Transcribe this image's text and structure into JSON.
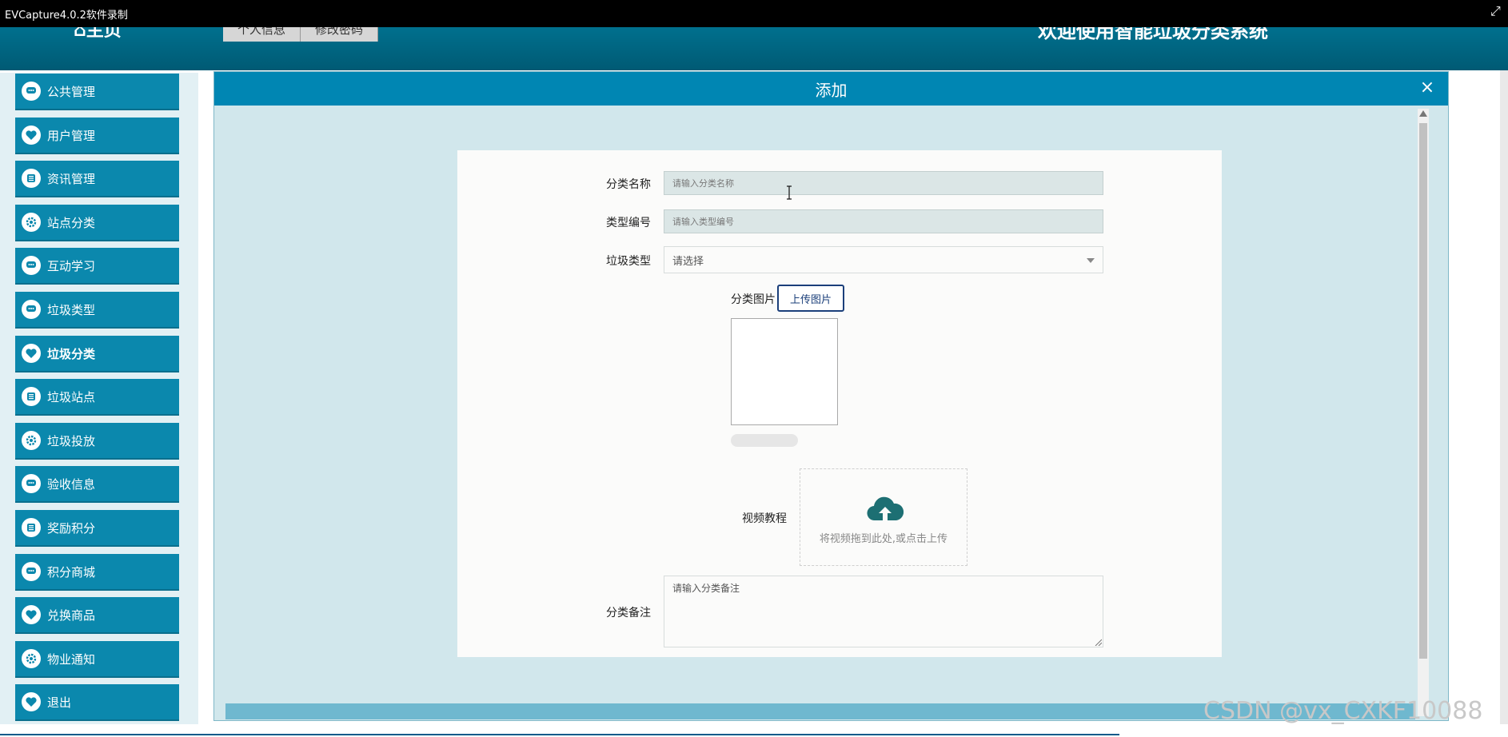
{
  "capture": {
    "title": "EVCapture4.0.2软件录制"
  },
  "header": {
    "home": "⌂主页",
    "tabs": [
      "个人信息",
      "修改密码"
    ],
    "welcome": "欢迎使用智能垃圾分类系统"
  },
  "sidebar": {
    "items": [
      {
        "label": "公共管理",
        "icon": "chat-icon"
      },
      {
        "label": "用户管理",
        "icon": "heart-icon"
      },
      {
        "label": "资讯管理",
        "icon": "list-icon"
      },
      {
        "label": "站点分类",
        "icon": "gear-icon"
      },
      {
        "label": "互动学习",
        "icon": "chat-icon"
      },
      {
        "label": "垃圾类型",
        "icon": "chat-icon"
      },
      {
        "label": "垃圾分类",
        "icon": "heart-icon",
        "active": true
      },
      {
        "label": "垃圾站点",
        "icon": "list-icon"
      },
      {
        "label": "垃圾投放",
        "icon": "gear-icon"
      },
      {
        "label": "验收信息",
        "icon": "chat-icon"
      },
      {
        "label": "奖励积分",
        "icon": "list-icon"
      },
      {
        "label": "积分商城",
        "icon": "chat-icon"
      },
      {
        "label": "兑换商品",
        "icon": "heart-icon"
      },
      {
        "label": "物业通知",
        "icon": "gear-icon"
      },
      {
        "label": "退出",
        "icon": "heart-icon"
      }
    ]
  },
  "modal": {
    "title": "添加",
    "close": "×",
    "form": {
      "name_label": "分类名称",
      "name_placeholder": "请输入分类名称",
      "code_label": "类型编号",
      "code_placeholder": "请输入类型编号",
      "type_label": "垃圾类型",
      "type_value": "请选择",
      "image_label": "分类图片",
      "upload_button": "上传图片",
      "video_label": "视频教程",
      "video_hint": "将视频拖到此处,或点击上传",
      "remark_label": "分类备注",
      "remark_placeholder": "请输入分类备注"
    }
  },
  "watermark": "CSDN @vx_CXKF10088",
  "colors": {
    "header": "#00708e",
    "menu": "#0b88ad",
    "modal_header": "#0086b3",
    "modal_bg": "#d1e7ec",
    "upload_border": "#1b3f7a",
    "cloud": "#1d6f73"
  }
}
